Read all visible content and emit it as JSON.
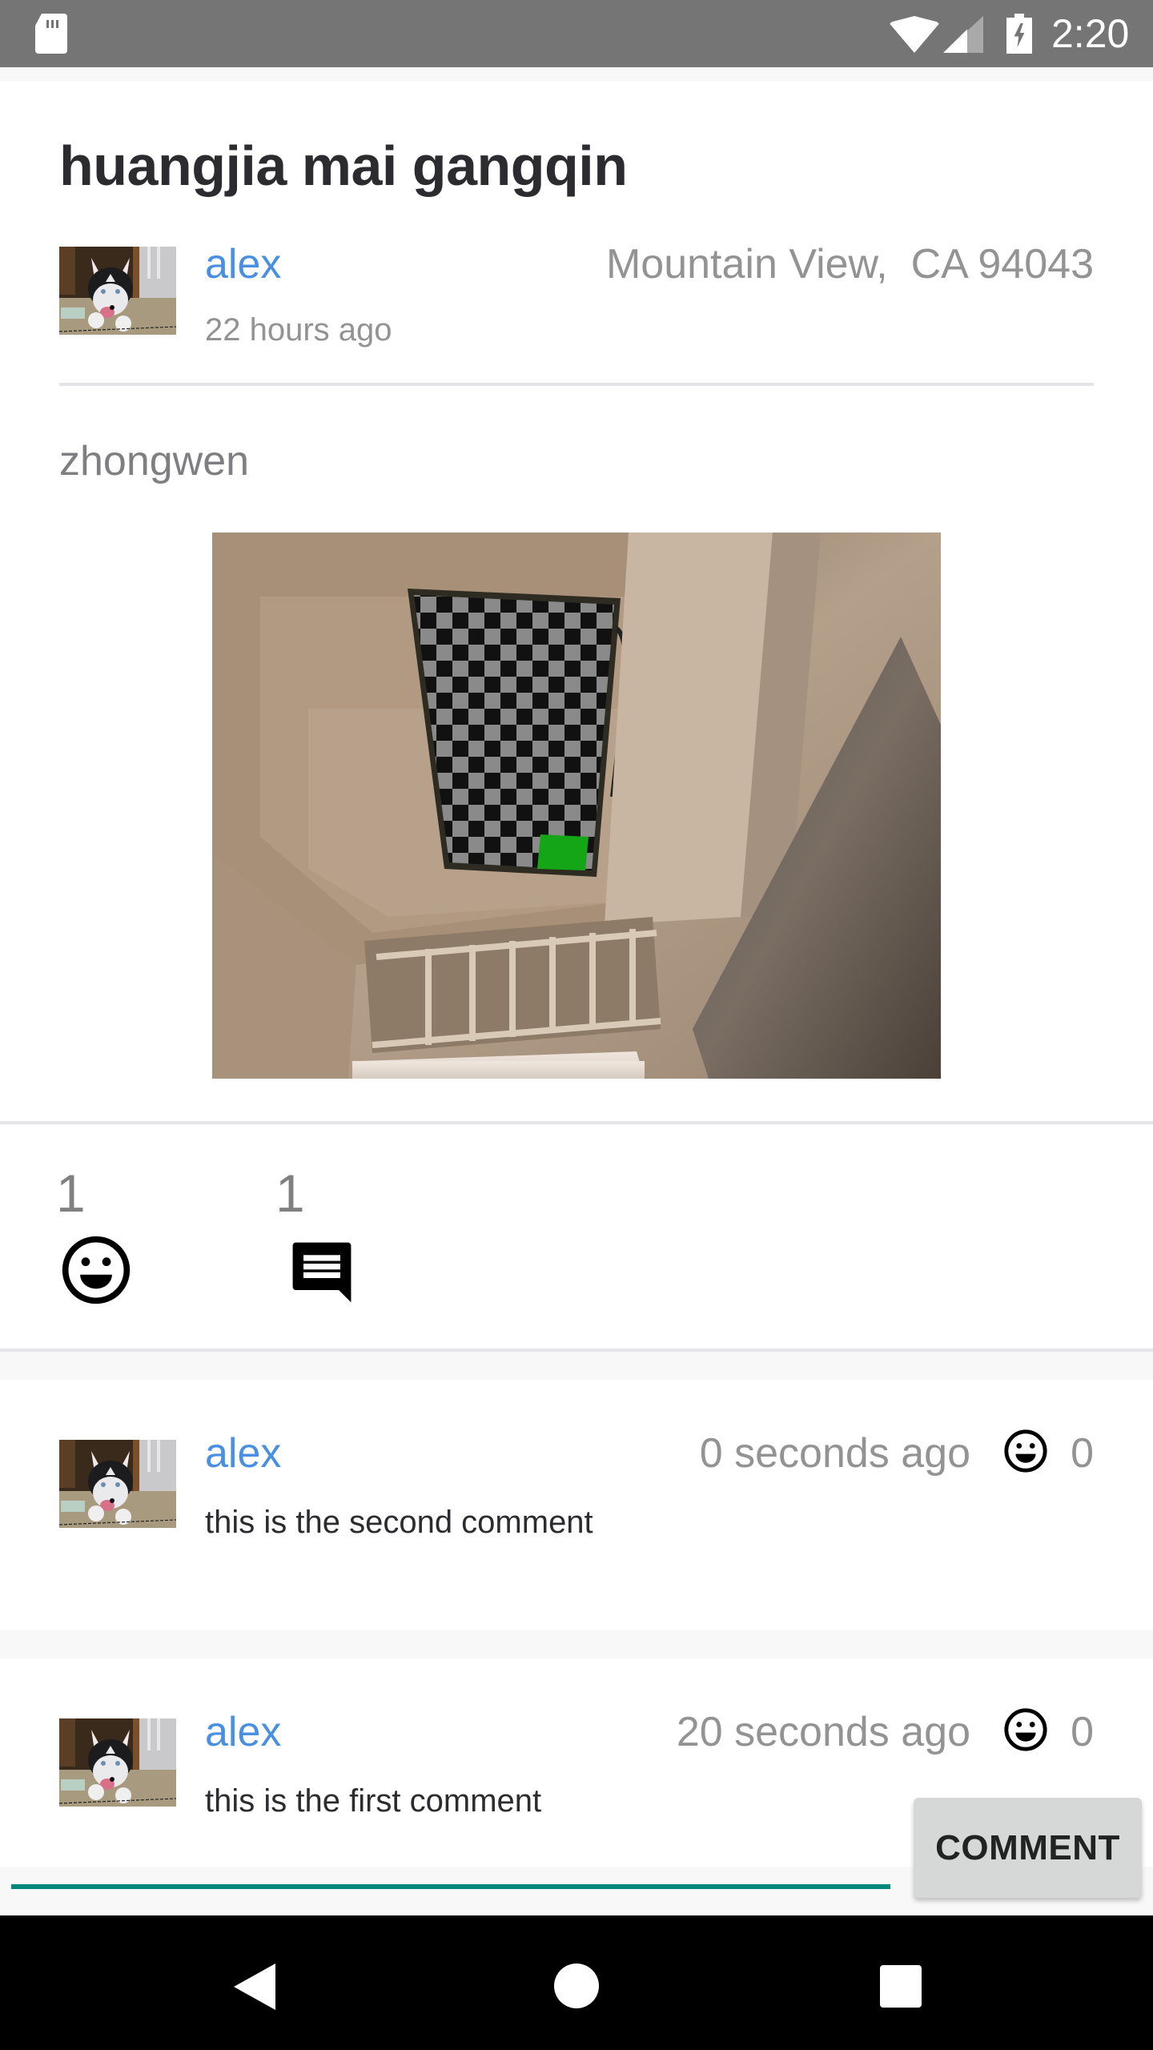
{
  "status_bar": {
    "time": "2:20",
    "icons": [
      "sd-card-icon",
      "wifi-icon",
      "cell-signal-icon",
      "battery-charging-icon"
    ]
  },
  "post": {
    "title": "huangjia mai gangqin",
    "author": "alex",
    "time_ago": "22 hours ago",
    "location": "Mountain View,  CA 94043",
    "body": "zhongwen",
    "photo_alt": "Room photo with checkerboard panel on ceiling",
    "stats": {
      "like_count": "1",
      "comment_count": "1",
      "like_icon": "smiley-icon",
      "comment_icon": "comment-icon"
    }
  },
  "comments": [
    {
      "author": "alex",
      "time_ago": "0 seconds ago",
      "like_count": "0",
      "text": "this is the second comment"
    },
    {
      "author": "alex",
      "time_ago": "20 seconds ago",
      "like_count": "0",
      "text": "this is the first comment"
    }
  ],
  "composer": {
    "input_value": "",
    "button_label": "COMMENT",
    "accent_color": "#00897b"
  },
  "colors": {
    "link": "#4a90e2",
    "muted": "#939393",
    "status_bar": "#757575"
  },
  "nav_bar": {
    "buttons": [
      "back",
      "home",
      "recents"
    ]
  }
}
